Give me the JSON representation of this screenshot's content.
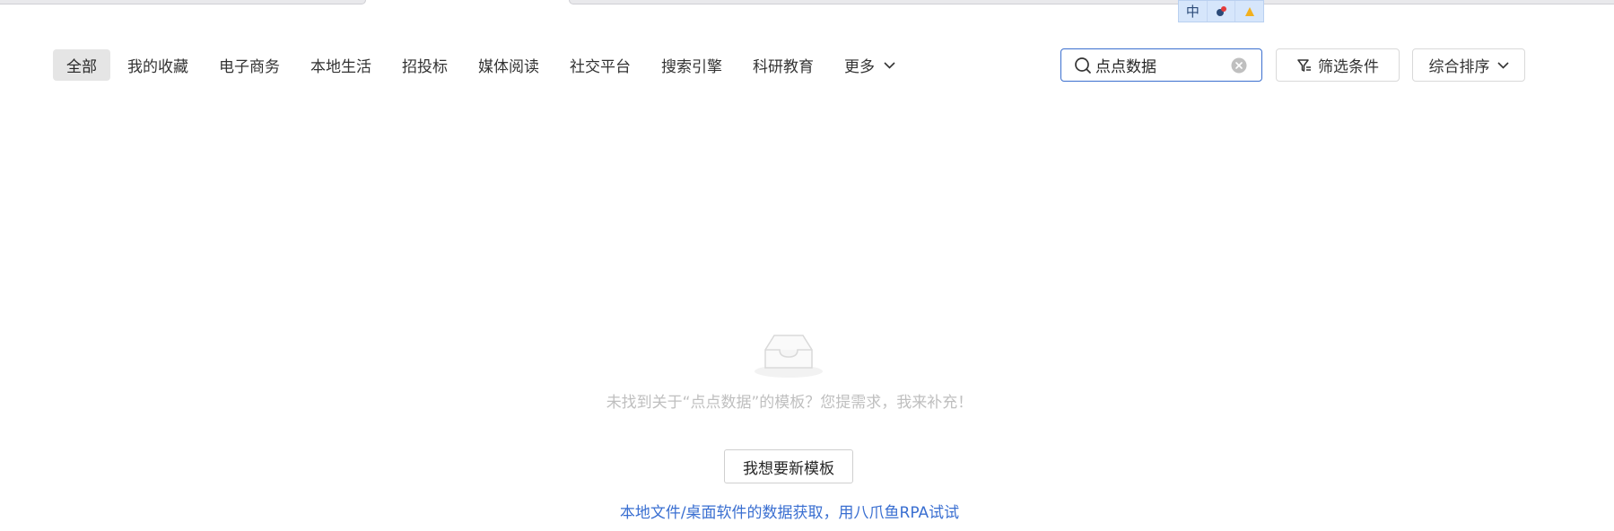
{
  "ime": {
    "lang": "中",
    "items": [
      "中",
      "mic",
      "skin"
    ]
  },
  "categories": [
    {
      "label": "全部",
      "active": true
    },
    {
      "label": "我的收藏"
    },
    {
      "label": "电子商务"
    },
    {
      "label": "本地生活"
    },
    {
      "label": "招投标"
    },
    {
      "label": "媒体阅读"
    },
    {
      "label": "社交平台"
    },
    {
      "label": "搜索引擎"
    },
    {
      "label": "科研教育"
    },
    {
      "label": "更多"
    }
  ],
  "search": {
    "value": "点点数据",
    "placeholder": ""
  },
  "toolbar": {
    "filter_label": "筛选条件",
    "sort_label": "综合排序"
  },
  "empty": {
    "message": "未找到关于“点点数据”的模板？您提需求，我来补充！",
    "button_label": "我想要新模板",
    "link_label": "本地文件/桌面软件的数据获取，用八爪鱼RPA试试"
  },
  "colors": {
    "accent": "#3a6fd1",
    "active_bg": "#e5e5e5",
    "muted_text": "#bfbfbf"
  }
}
